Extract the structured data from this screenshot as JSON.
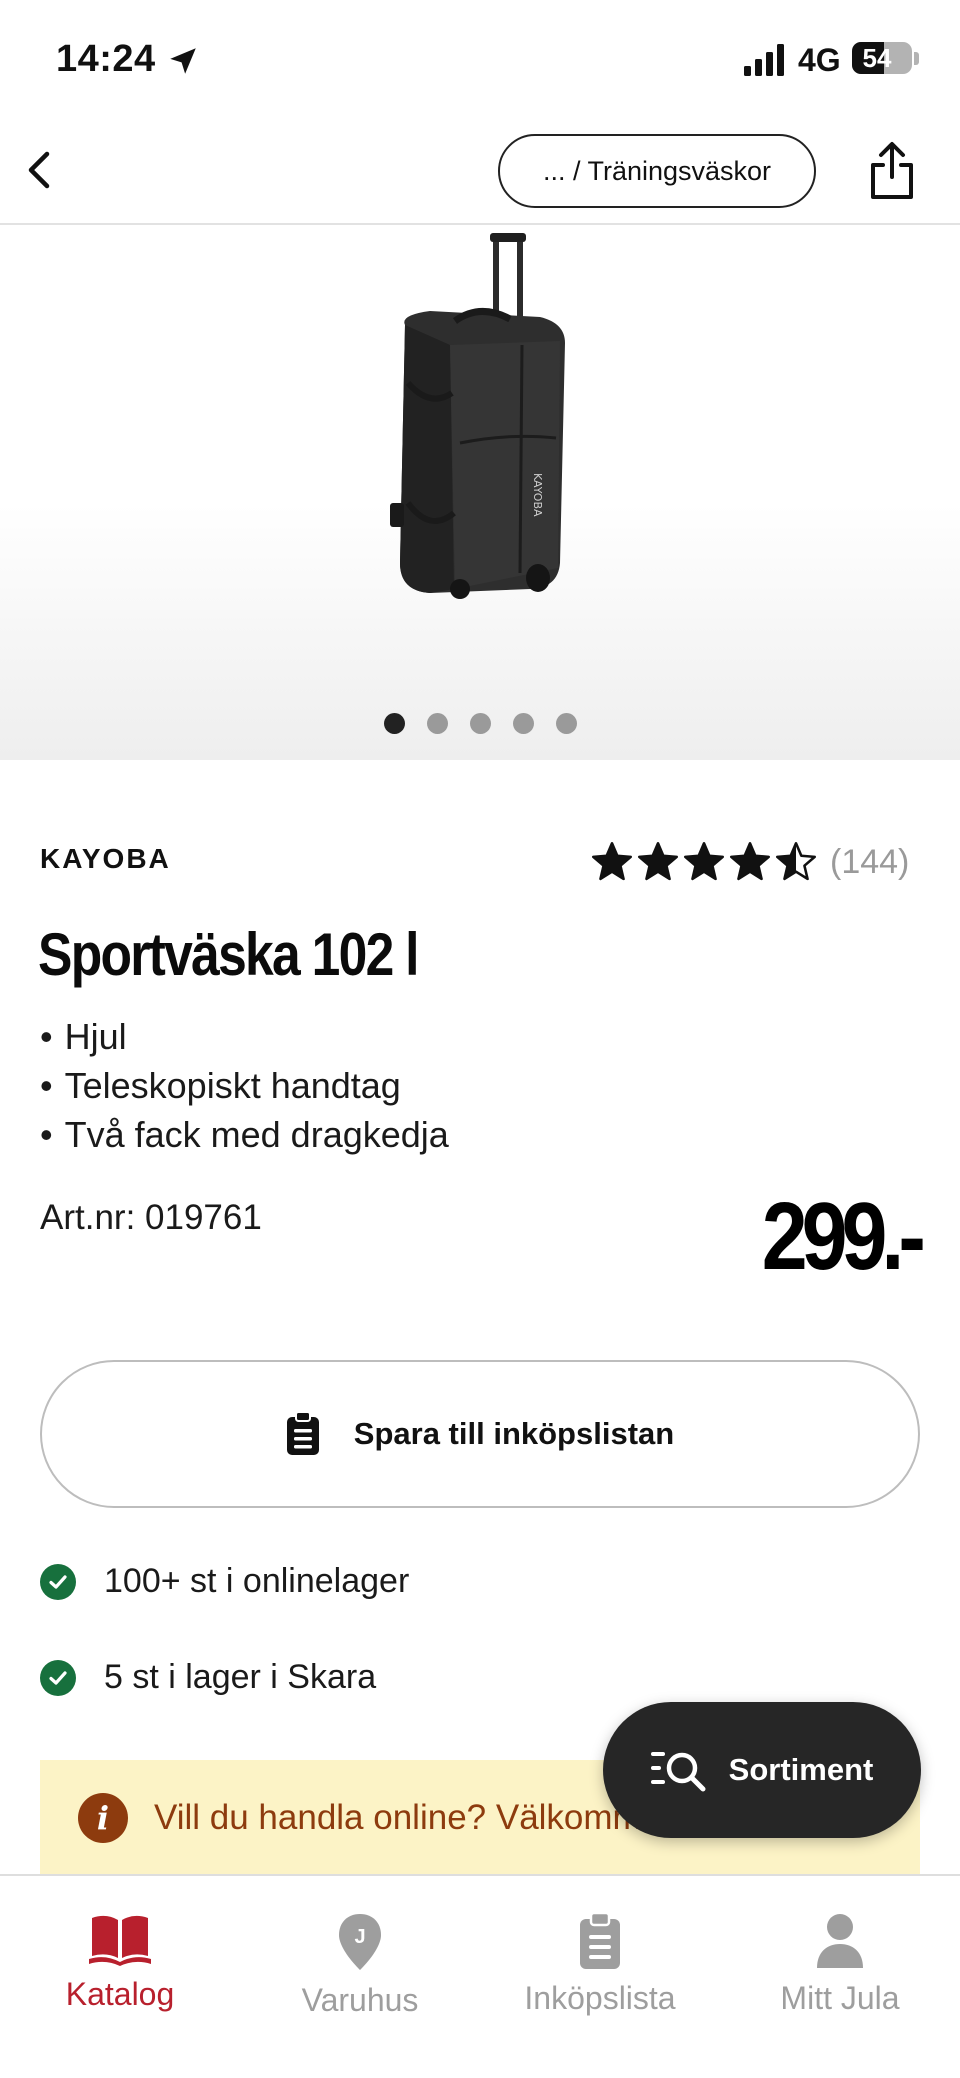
{
  "status_bar": {
    "time": "14:24",
    "network": "4G",
    "battery_level": "54",
    "battery_percent": 54
  },
  "nav": {
    "breadcrumb": "... / Träningsväskor",
    "back_icon": "chevron-left-icon",
    "share_icon": "share-icon"
  },
  "gallery": {
    "image_count": 5,
    "active_index": 0
  },
  "product": {
    "brand": "KAYOBA",
    "rating": 4.5,
    "rating_count": "(144)",
    "title": "Sportväska 102 l",
    "features": [
      "Hjul",
      "Teleskopiskt handtag",
      "Två fack med dragkedja"
    ],
    "art_label": "Art.nr:",
    "art_number": "019761",
    "price": "299.-"
  },
  "actions": {
    "save_label": "Spara till inköpslistan"
  },
  "stock": {
    "online": "100+ st i onlinelager",
    "store": "5 st i lager i Skara"
  },
  "banner": {
    "text": "Vill du handla online? Välkommen"
  },
  "sortiment": {
    "label": "Sortiment"
  },
  "tabs": [
    {
      "label": "Katalog",
      "icon": "book-icon"
    },
    {
      "label": "Varuhus",
      "icon": "store-pin-icon"
    },
    {
      "label": "Inköpslista",
      "icon": "clipboard-icon"
    },
    {
      "label": "Mitt Jula",
      "icon": "person-icon"
    }
  ],
  "colors": {
    "accent_red": "#b8202d",
    "stock_green": "#17703d",
    "banner_bg": "#fcf3c6",
    "banner_text": "#8d3b0e",
    "inactive_tab": "#9e9e9e"
  }
}
